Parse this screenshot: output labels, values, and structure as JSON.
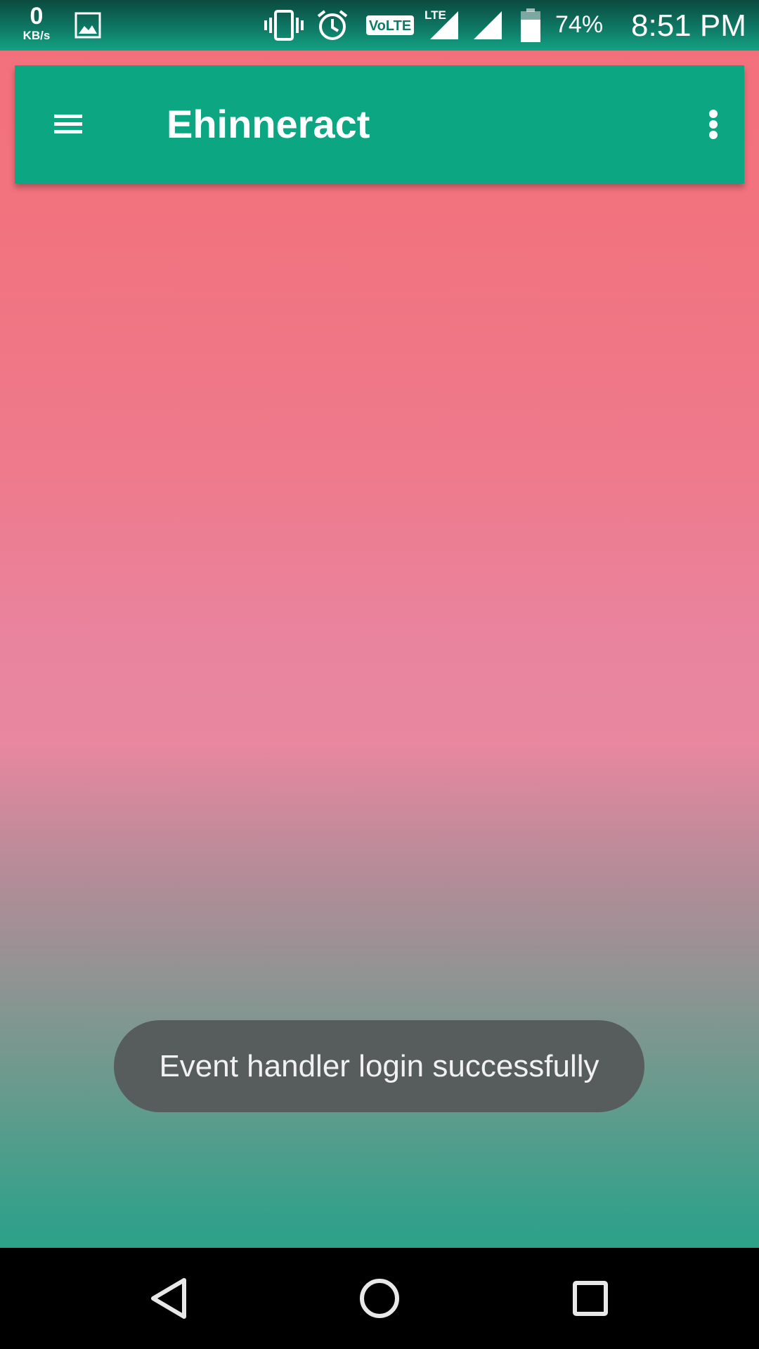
{
  "status_bar": {
    "net_speed_value": "0",
    "net_speed_unit": "KB/s",
    "battery_percent": "74%",
    "time": "8:51 PM",
    "volte_label": "VoLTE",
    "lte_label": "LTE",
    "icons": [
      "image-notification-icon",
      "vibrate-icon",
      "alarm-icon",
      "volte-icon",
      "lte-signal-icon",
      "signal-icon",
      "battery-icon"
    ]
  },
  "toolbar": {
    "title": "Ehinneract",
    "menu_icon": "hamburger-menu-icon",
    "overflow_icon": "more-vert-icon",
    "color": "#0ca683"
  },
  "toast": {
    "message": "Event handler login successfully"
  },
  "nav_bar": {
    "icons": [
      "back-icon",
      "home-icon",
      "recents-icon"
    ]
  },
  "colors": {
    "gradient_top": "#f2707c",
    "gradient_mid": "#e9879f",
    "gradient_bottom": "#15a584",
    "toast_bg": "#575d5c"
  }
}
